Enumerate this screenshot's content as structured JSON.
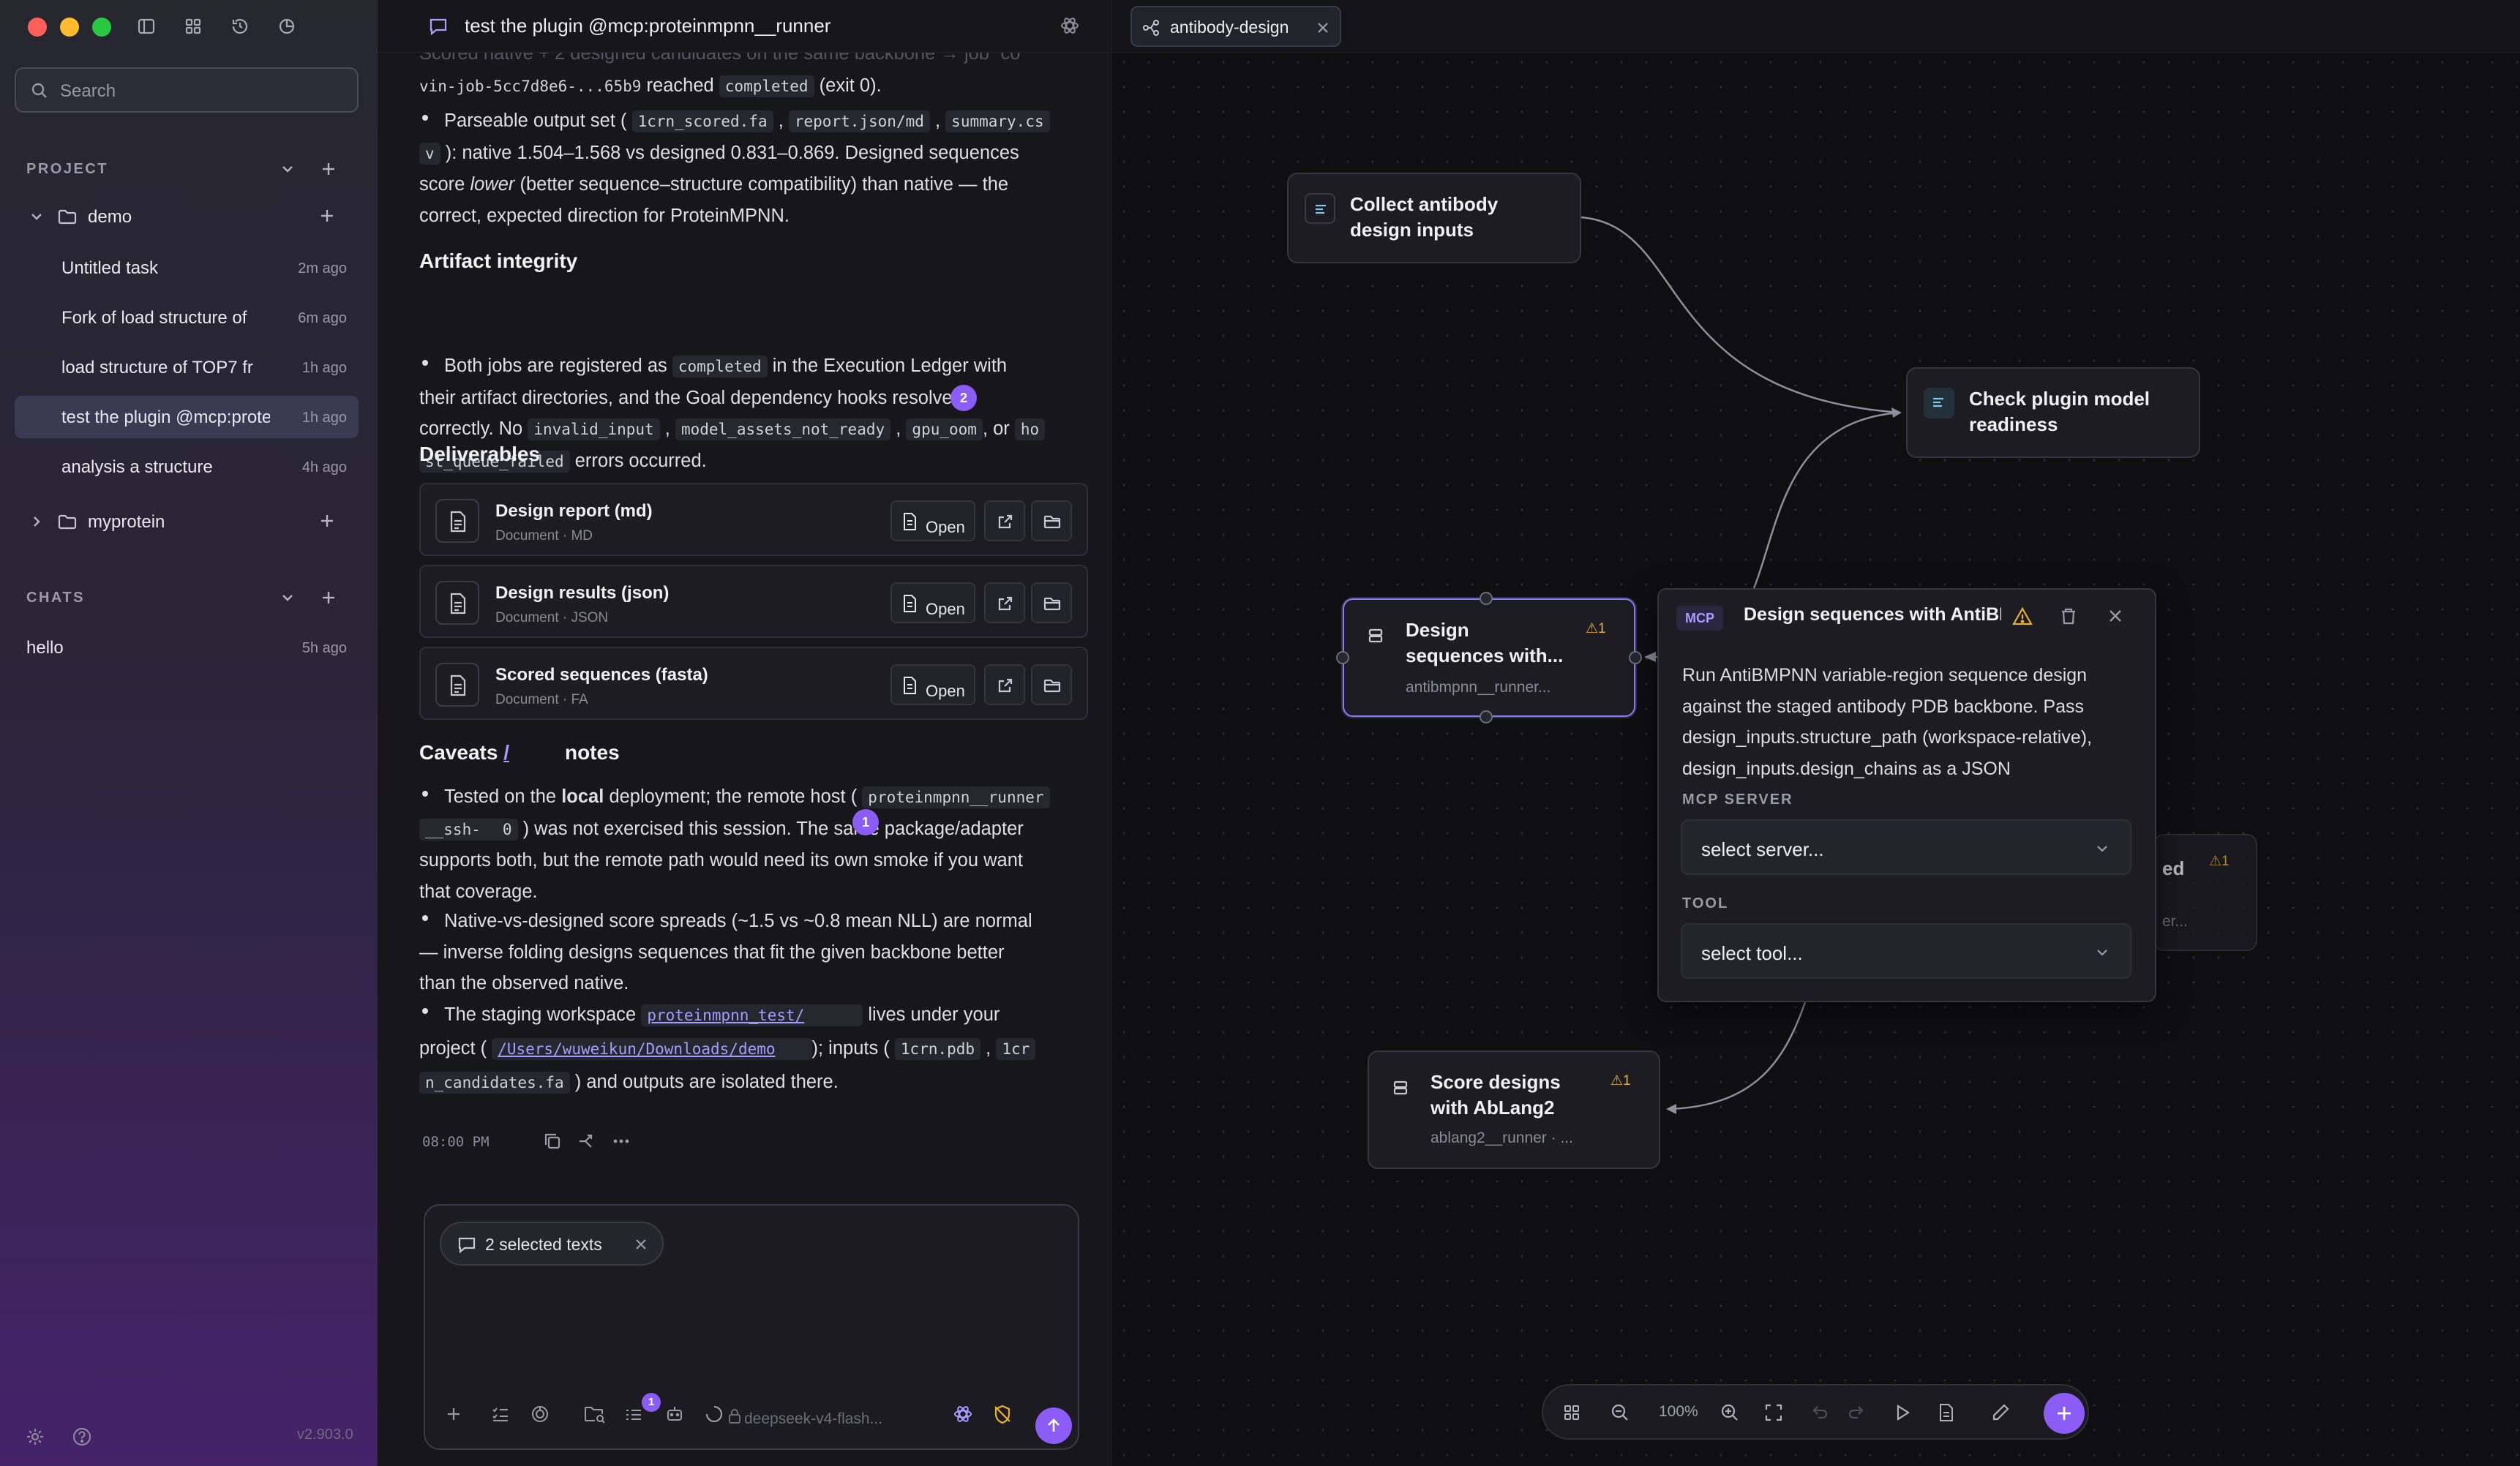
{
  "sidebar": {
    "search_placeholder": "Search",
    "project_title": "PROJECT",
    "chats_title": "CHATS",
    "folders": [
      {
        "label": "demo"
      },
      {
        "label": "myprotein"
      }
    ],
    "tasks": [
      {
        "label": "Untitled task",
        "time": "2m ago"
      },
      {
        "label": "Fork of load structure of",
        "time": "6m ago"
      },
      {
        "label": "load structure of TOP7 fr",
        "time": "1h ago"
      },
      {
        "label": "test the plugin @mcp:proteinmpnn__runner",
        "time": "1h ago"
      },
      {
        "label": "analysis a structure",
        "time": "4h ago"
      }
    ],
    "chats": [
      {
        "label": "hello",
        "time": "5h ago"
      }
    ],
    "version": "v2.903.0"
  },
  "chat": {
    "title": "test the plugin @mcp:proteinmpnn__runner",
    "top_fade": "Scored native + 2 designed candidates on the same backbone → job `co",
    "line_job_code": "vin-job-5cc7d8e6-...65b9",
    "line_job_reached": "reached",
    "line_job_status": "completed",
    "line_job_exit": "(exit 0).",
    "p1_a": "Parseable output set (",
    "p1_c1": "1crn_scored.fa",
    "p1_comma": ",",
    "p1_c2": "report.json/md",
    "p1_c3": "summary.cs",
    "p1_c3b": "v",
    "p1_b": "): native 1.504–1.568 vs designed 0.831–0.869. Designed sequences",
    "p1_c": "score",
    "p1_lower": "lower",
    "p1_d": "(better sequence–structure compatibility) than native — the",
    "p1_e": "correct, expected direction for ProteinMPNN.",
    "h_artifact": "Artifact integrity",
    "p2_a": "Both jobs are registered as",
    "p2_code": "completed",
    "p2_b": "in the Execution Ledger with",
    "p2_c": "their artifact directories, and the Goal dependency hooks resolved",
    "p2_d": "correctly. No",
    "p2_e1": "invalid_input",
    "p2_e2": "model_assets_not_ready",
    "p2_e3": "gpu_oom",
    "p2_or": ", or",
    "p2_e4": "ho",
    "p2_e4b": "st_queue_failed",
    "p2_f": "errors occurred.",
    "badge_2": "2",
    "h_deliv": "Deliverables",
    "deliverables": [
      {
        "title": "Design report (md)",
        "sub": "Document · MD",
        "open": "Open"
      },
      {
        "title": "Design results (json)",
        "sub": "Document · JSON",
        "open": "Open"
      },
      {
        "title": "Scored sequences (fasta)",
        "sub": "Document · FA",
        "open": "Open"
      }
    ],
    "h_caveats_a": "Caveats",
    "h_caveats_slash": "/",
    "h_caveats_b": "notes",
    "c1_a": "Tested on the",
    "c1_local": "local",
    "c1_b": "deployment; the remote host (",
    "c1_code": "proteinmpnn__runner",
    "c1_code2": "__ssh-",
    "c1_code3": "0",
    "c1_c": ") was not exercised this session. The same package/adapter",
    "c1_d": "supports both, but the remote path would need its own smoke if you want",
    "c1_e": "that coverage.",
    "badge_1": "1",
    "c2_a": "Native-vs-designed score spreads (~1.5 vs ~0.8 mean NLL) are normal",
    "c2_b": "— inverse folding designs sequences that fit the given backbone better",
    "c2_c": "than the observed native.",
    "c3_a": "The staging workspace",
    "c3_code": "proteinmpnn_test/",
    "c3_b": "lives under your",
    "c3_c": "project (",
    "c3_path": "/Users/wuweikun/Downloads/demo",
    "c3_d": "); inputs (",
    "c3_i1": "1crn.pdb",
    "c3_i2": "1cr",
    "c3_i2b": "n_candidates.fa",
    "c3_e": ") and outputs are isolated there.",
    "timestamp": "08:00 PM",
    "selected_chip": "2 selected texts",
    "tool_badge": "1",
    "model": "deepseek-v4-flash..."
  },
  "canvas": {
    "tab_label": "antibody-design",
    "nodes": {
      "collect": {
        "title_1": "Collect antibody",
        "title_2": "design inputs"
      },
      "check": {
        "title_1": "Check plugin model",
        "title_2": "readiness"
      },
      "design": {
        "title_1": "Design",
        "title_2": "sequences with...",
        "sub": "antibmpnn__runner...",
        "warn": "⚠1"
      },
      "hidden": {
        "title_frag": "ed",
        "sub_frag": "er...",
        "warn": "⚠1"
      },
      "score": {
        "title_1": "Score designs",
        "title_2": "with AbLang2",
        "sub": "ablang2__runner · ...",
        "warn": "⚠1"
      }
    },
    "popup": {
      "badge": "MCP",
      "title": "Design sequences with AntiBMPNN",
      "description": "Run AntiBMPNN variable-region sequence design against the staged antibody PDB backbone. Pass design_inputs.structure_path (workspace-relative), design_inputs.design_chains as a JSON",
      "server_label": "MCP SERVER",
      "server_value": "select server...",
      "tool_label": "TOOL",
      "tool_value": "select tool..."
    },
    "zoom": "100%"
  },
  "colors": {
    "accent": "#8b5cf6",
    "warning": "#e8b030",
    "link": "#a99bff"
  }
}
